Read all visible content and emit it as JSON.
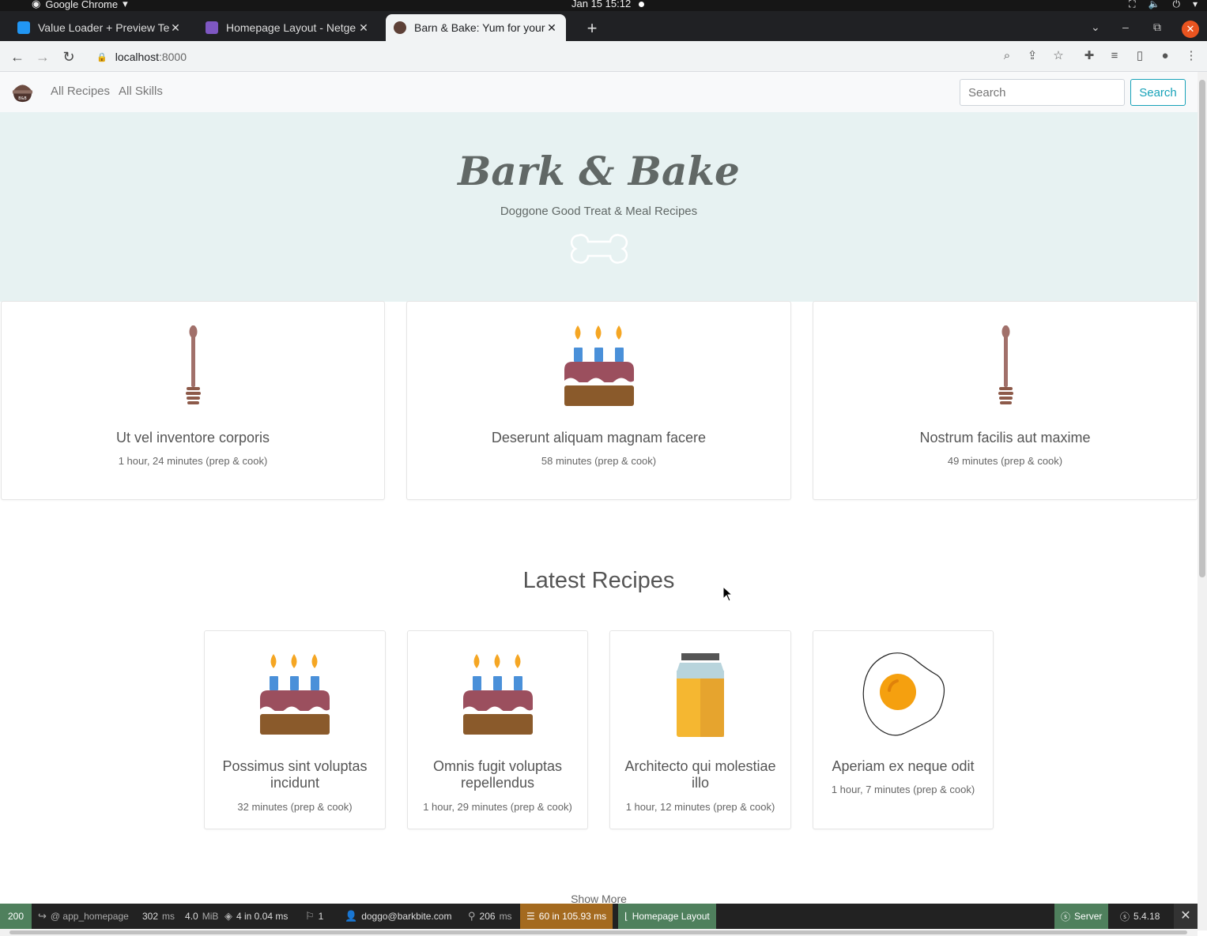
{
  "os": {
    "app_name": "Google Chrome",
    "clock": "Jan 15  15:12"
  },
  "browser": {
    "tabs": [
      {
        "title": "Value Loader + Preview Te",
        "favicon_color": "#2196f3"
      },
      {
        "title": "Homepage Layout - Netge",
        "favicon_color": "#7e57c2"
      },
      {
        "title": "Barn & Bake: Yum for your",
        "favicon_color": "#5d4037"
      }
    ],
    "url_host": "localhost",
    "url_port": ":8000"
  },
  "site": {
    "nav": {
      "all_recipes": "All Recipes",
      "all_skills": "All Skills"
    },
    "search": {
      "placeholder": "Search",
      "button": "Search"
    },
    "hero": {
      "title": "Bark & Bake",
      "subtitle": "Doggone Good Treat & Meal Recipes"
    },
    "featured": [
      {
        "icon": "honey-dipper-icon",
        "title": "Ut vel inventore corporis",
        "time": "1 hour, 24 minutes (prep & cook)"
      },
      {
        "icon": "birthday-cake-icon",
        "title": "Deserunt aliquam magnam facere",
        "time": "58 minutes (prep & cook)"
      },
      {
        "icon": "honey-dipper-icon",
        "title": "Nostrum facilis aut maxime",
        "time": "49 minutes (prep & cook)"
      }
    ],
    "latest_title": "Latest Recipes",
    "latest": [
      {
        "icon": "birthday-cake-icon",
        "title": "Possimus sint voluptas incidunt",
        "time": "32 minutes (prep & cook)"
      },
      {
        "icon": "birthday-cake-icon",
        "title": "Omnis fugit voluptas repellendus",
        "time": "1 hour, 29 minutes (prep & cook)"
      },
      {
        "icon": "honey-jar-icon",
        "title": "Architecto qui molestiae illo",
        "time": "1 hour, 12 minutes (prep & cook)"
      },
      {
        "icon": "fried-egg-icon",
        "title": "Aperiam ex neque odit",
        "time": "1 hour, 7 minutes (prep & cook)"
      }
    ],
    "show_more": "Show More"
  },
  "toolbar": {
    "status": "200",
    "route": "@ app_homepage",
    "time": "302",
    "time_unit": "ms",
    "memory": "4.0",
    "memory_unit": "MiB",
    "forms": "4 in 0.04 ms",
    "translations": "1",
    "user": "doggo@barkbite.com",
    "twig": "206",
    "twig_unit": "ms",
    "db": "60 in 105.93 ms",
    "layout": "Homepage Layout",
    "server": "Server",
    "version": "5.4.18"
  }
}
